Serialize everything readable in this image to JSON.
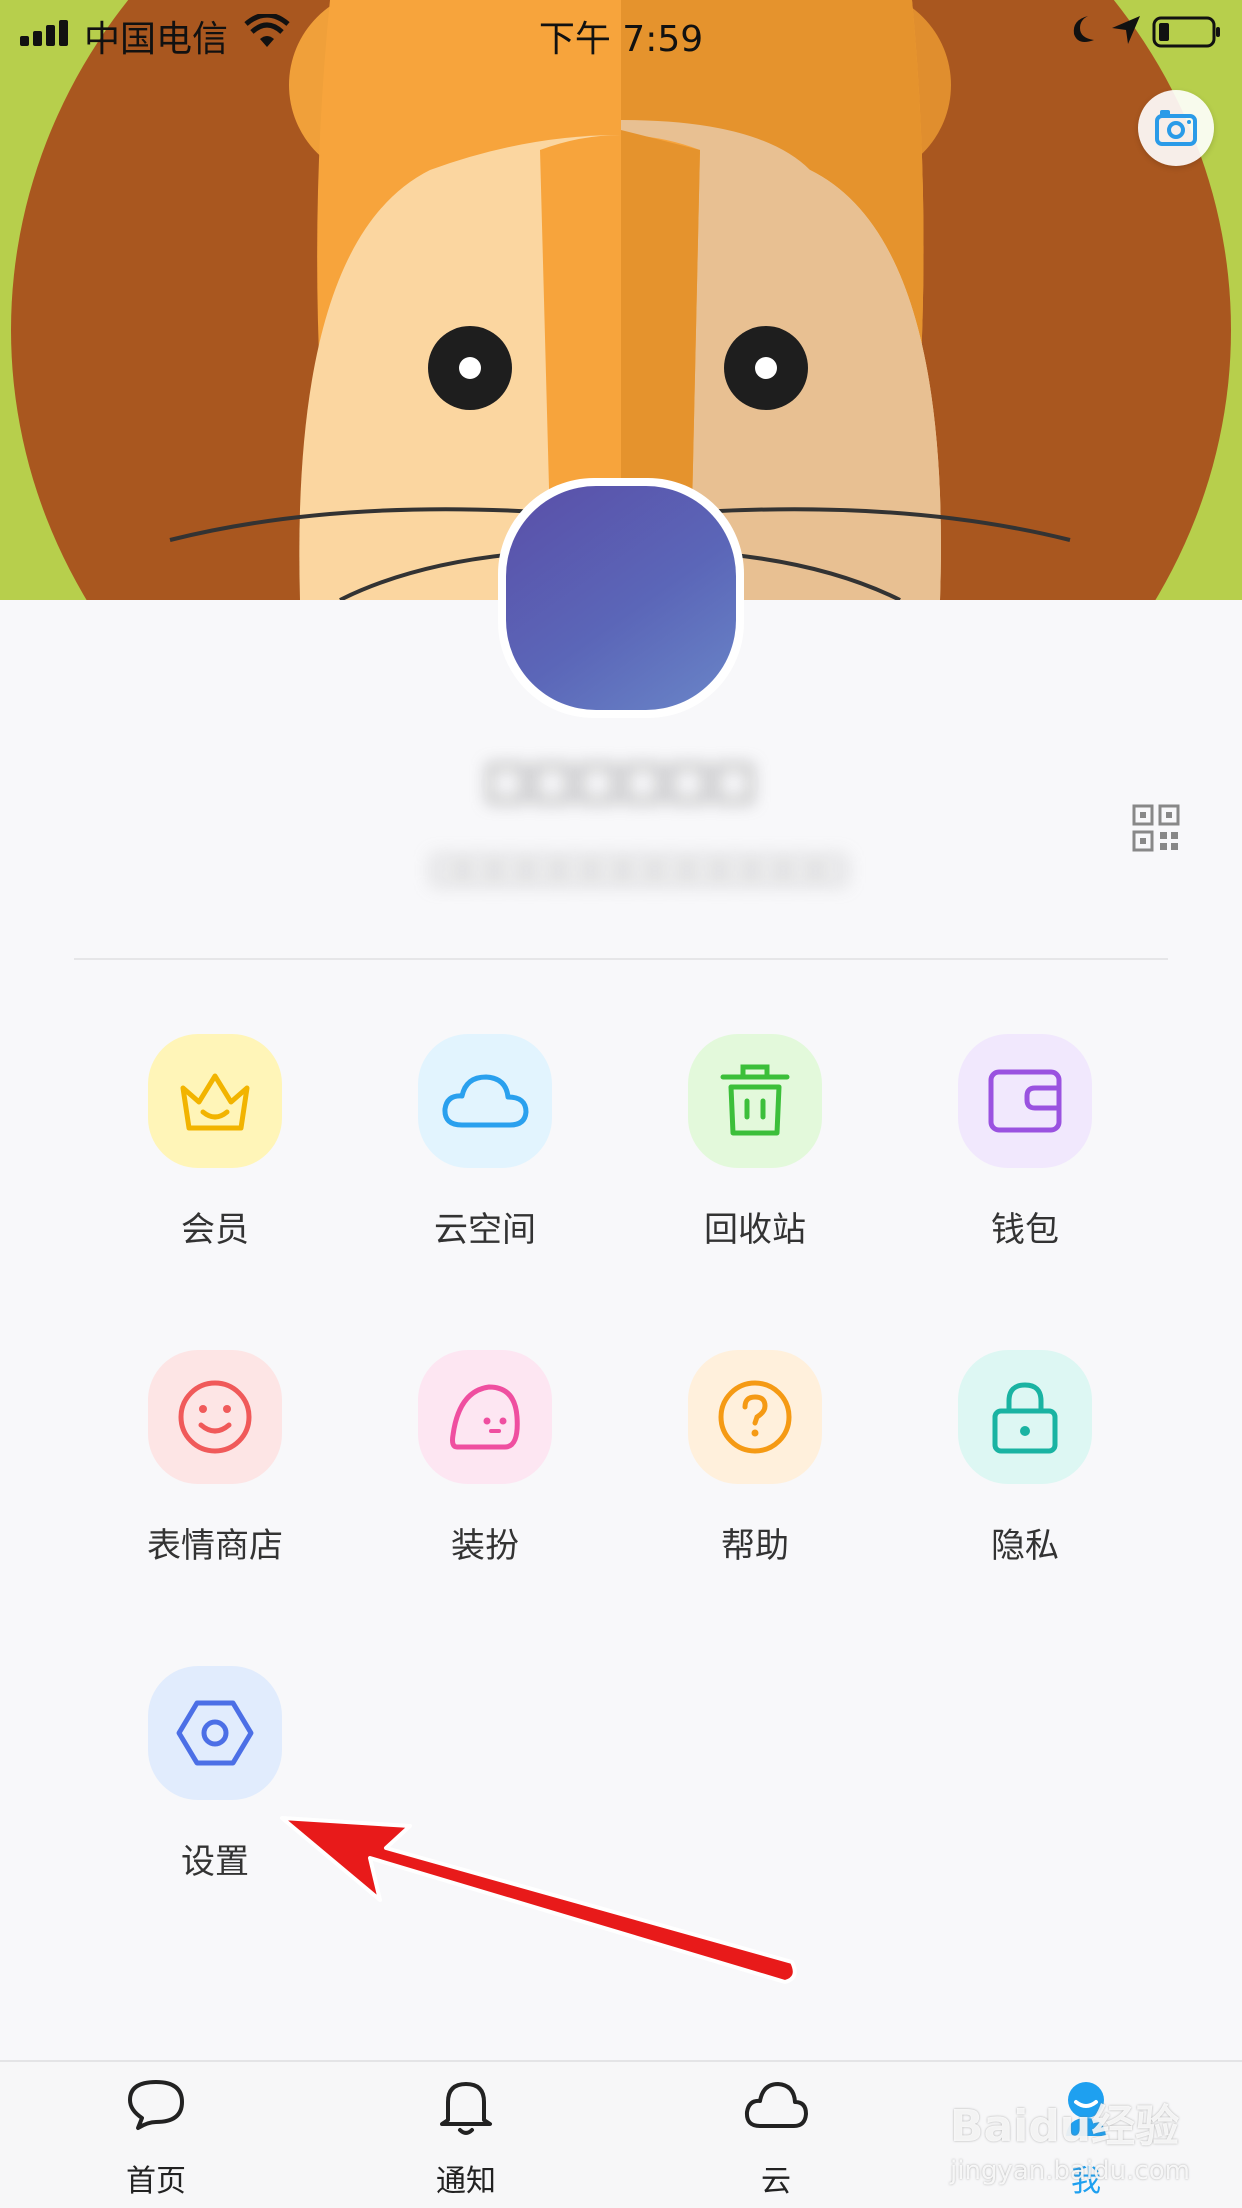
{
  "status_bar": {
    "carrier": "中国电信",
    "time": "下午 7:59"
  },
  "profile": {
    "name": "□□□□□□",
    "subtitle": "□□□□□□□□□□□□□"
  },
  "grid": [
    {
      "label": "会员",
      "icon": "crown-icon",
      "bg": "#fff5b8",
      "color": "#f2b400"
    },
    {
      "label": "云空间",
      "icon": "cloud-icon",
      "bg": "#e2f4fe",
      "color": "#2aa0ee"
    },
    {
      "label": "回收站",
      "icon": "trash-icon",
      "bg": "#e3f9db",
      "color": "#3cbf3a"
    },
    {
      "label": "钱包",
      "icon": "wallet-icon",
      "bg": "#f1e8fd",
      "color": "#9a52e0"
    },
    {
      "label": "表情商店",
      "icon": "smile-icon",
      "bg": "#fde5e5",
      "color": "#f05a5a"
    },
    {
      "label": "装扮",
      "icon": "dress-up-icon",
      "bg": "#fde6f2",
      "color": "#ef4fa0"
    },
    {
      "label": "帮助",
      "icon": "help-icon",
      "bg": "#fff0dc",
      "color": "#f59a14"
    },
    {
      "label": "隐私",
      "icon": "lock-icon",
      "bg": "#ddf7f3",
      "color": "#1ab3a2"
    },
    {
      "label": "设置",
      "icon": "settings-icon",
      "bg": "#e1ecfd",
      "color": "#4c6fe6"
    }
  ],
  "tabs": [
    {
      "label": "首页",
      "icon": "chat-bubble-icon"
    },
    {
      "label": "通知",
      "icon": "bell-icon"
    },
    {
      "label": "云",
      "icon": "cloud-icon"
    },
    {
      "label": "我",
      "icon": "profile-icon",
      "active": true
    }
  ],
  "watermark": {
    "brand": "Baidu经验",
    "url": "jingyan.baidu.com"
  }
}
